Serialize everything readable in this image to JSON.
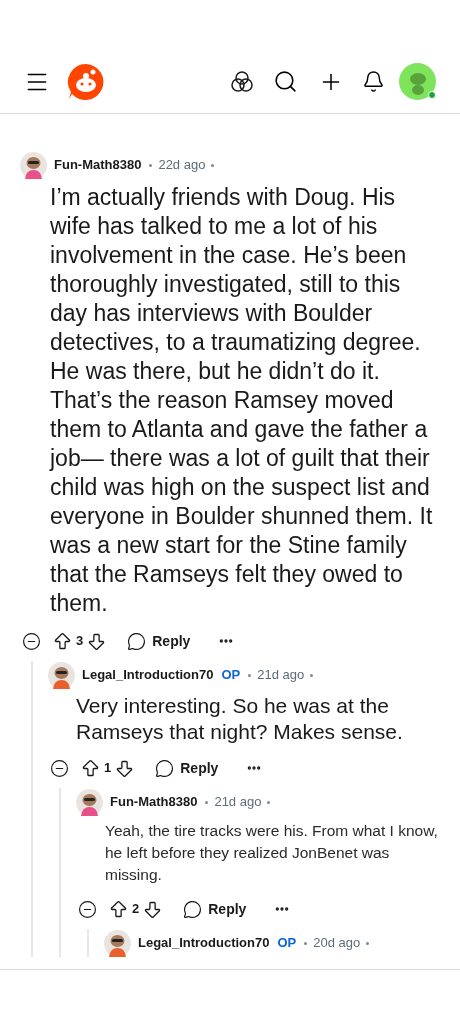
{
  "header": {
    "notifications": true
  },
  "comments": [
    {
      "author": "Fun-Math8380",
      "age": "22d ago",
      "body": "I’m actually friends with Doug. His wife has talked to me a lot of his involvement in the case. He’s been thoroughly investigated, still to this day has interviews with Boulder detectives, to a traumatizing degree. He was there, but he didn’t do it. That’s the reason Ramsey moved them to Atlanta and gave the father a job— there was a lot of guilt that their child was high on the suspect list and everyone in Boulder shunned them. It was a new start for the Stine family that the Ramseys felt they owed to them.",
      "votes": "3",
      "reply": "Reply",
      "children": [
        {
          "author": "Legal_Introduction70",
          "op_label": "OP",
          "age": "21d ago",
          "body": "Very interesting. So he was at the Ramseys that night? Makes sense.",
          "votes": "1",
          "reply": "Reply",
          "children": [
            {
              "author": "Fun-Math8380",
              "age": "21d ago",
              "body": "Yeah, the tire tracks were his. From what I know, he left before they realized JonBenet was missing.",
              "votes": "2",
              "reply": "Reply",
              "children": [
                {
                  "author": "Legal_Introduction70",
                  "op_label": "OP",
                  "age": "20d ago"
                }
              ]
            }
          ]
        }
      ]
    }
  ]
}
